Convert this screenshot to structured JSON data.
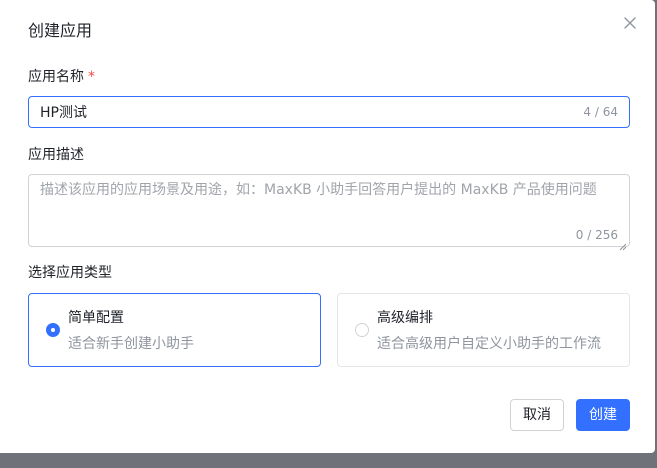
{
  "dialog": {
    "title": "创建应用",
    "close_icon": "close-icon"
  },
  "name_field": {
    "label": "应用名称",
    "required_mark": "*",
    "value": "HP测试",
    "counter": "4 / 64"
  },
  "description_field": {
    "label": "应用描述",
    "placeholder": "描述该应用的应用场景及用途，如：MaxKB 小助手回答用户提出的 MaxKB 产品使用问题",
    "value": "",
    "counter": "0 / 256"
  },
  "app_type": {
    "label": "选择应用类型",
    "options": [
      {
        "title": "简单配置",
        "description": "适合新手创建小助手",
        "selected": true
      },
      {
        "title": "高级编排",
        "description": "适合高级用户自定义小助手的工作流",
        "selected": false
      }
    ]
  },
  "footer": {
    "cancel_label": "取消",
    "create_label": "创建"
  },
  "colors": {
    "primary": "#3370ff",
    "required": "#f54a45",
    "overlay": "#6f7278"
  }
}
